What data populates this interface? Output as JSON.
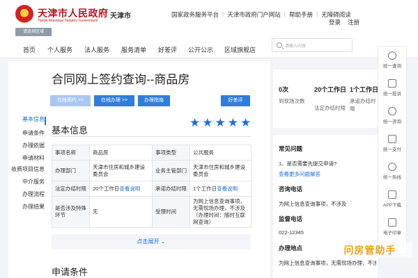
{
  "header": {
    "site_name": "天津市人民政府",
    "site_name_en": "Tianjin Municipal People's Government",
    "city": "天津市",
    "region_button": "请选择区域",
    "top_links": [
      "国家政务服务平台",
      "天津市政府门户网站",
      "帮助手册",
      "无障碍阅读"
    ],
    "login": "登录",
    "register": "注册"
  },
  "nav": {
    "items": [
      "首页",
      "个人服务",
      "法人服务",
      "服务清单",
      "好差评",
      "公开公示",
      "区域旗舰店"
    ],
    "search_placeholder": "请输入内容"
  },
  "page": {
    "title": "合同网上签约查询--商品房",
    "buttons": {
      "online_reserve": "在线预约 >>",
      "online_handle": "在线办理 >>",
      "guide": "办理指南",
      "rate": "好差评"
    },
    "section_basic": "基本信息",
    "expand": "点击展开",
    "section_apply": "申请条件"
  },
  "rating": {
    "stars": 5
  },
  "side_menu": [
    "基本信息",
    "申请条件",
    "办理依据",
    "申请材料",
    "收费项目信息",
    "中介服务",
    "办理流程",
    "办理结果"
  ],
  "table": {
    "rows": [
      [
        {
          "k": "事项名称"
        },
        {
          "v": "商品房"
        },
        {
          "k": "事项类型"
        },
        {
          "v": "公共服务"
        }
      ],
      [
        {
          "k": "办理部门"
        },
        {
          "v": "天津市住房和城乡建设委员会"
        },
        {
          "k": "业务主管部门"
        },
        {
          "v": "天津市住房和城乡建设委员会"
        }
      ],
      [
        {
          "k": "法定办结时限"
        },
        {
          "v": "20个工作日",
          "link": "查看说明"
        },
        {
          "k": "承诺办结时限"
        },
        {
          "v": "1个工作日",
          "link": "查看说明"
        }
      ],
      [
        {
          "k": "是否涉及特殊环节"
        },
        {
          "v": "无"
        },
        {
          "k": "受理时间"
        },
        {
          "v": "为网上信息查询事项，无需现场办理，不涉及（办理时间：随时互联网查询）"
        }
      ]
    ]
  },
  "stats": [
    {
      "value": "0次",
      "label": "到现场次数"
    },
    {
      "value": "20个工作日",
      "label": "法定办结时限"
    },
    {
      "value": "1个工作日",
      "label": "承诺办结时限"
    }
  ],
  "right": {
    "faq_title": "常见问题",
    "faq_q": "1、是否需要先提交申请?",
    "faq_more": "查看更多问题解答",
    "consult_title": "咨询电话",
    "consult_text": "为网上信息查询事项，不涉及",
    "supervise_title": "监督电话",
    "supervise_phone": "022-12345",
    "place_title": "办理地点",
    "place_text": "为网上信息查询事项，无需现场办理，不涉及"
  },
  "float_bar": [
    "统一查询",
    "统一投诉",
    "统一咨询",
    "统一支付",
    "统一热线",
    "APP下载",
    "电子印章"
  ],
  "watermark": "问房管助手",
  "colors": {
    "brand_red": "#b8161e",
    "link_blue": "#1e6fd9",
    "btn_light": "#a8c8ef",
    "btn_blue": "#2f7ddc"
  }
}
